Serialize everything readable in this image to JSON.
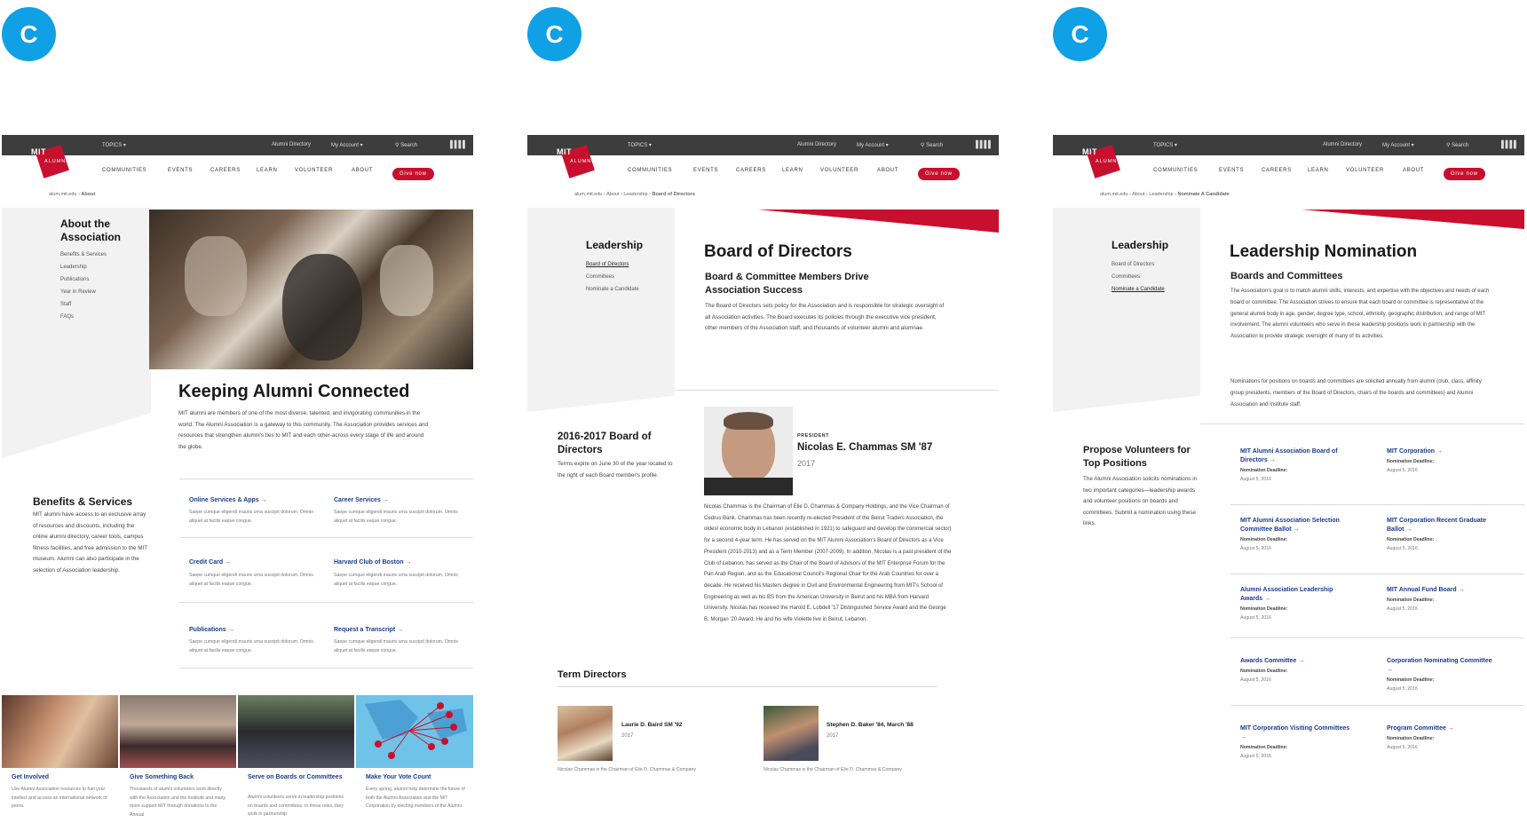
{
  "badge_letter": "C",
  "nav": {
    "topics": "TOPICS ▾",
    "directory": "Alumni Directory",
    "account": "My Account ▾",
    "search": "Search",
    "communities": "COMMUNITIES",
    "events": "EVENTS",
    "careers": "CAREERS",
    "learn": "LEARN",
    "volunteer": "VOLUNTEER",
    "about": "ABOUT",
    "give": "Give now",
    "logo_mit": "MIT",
    "logo_alumni": "ALUMNI"
  },
  "colors": {
    "accent": "#c8102e",
    "badge": "#0fa0e6",
    "link": "#1a3b8c",
    "topbar": "#3d3d3d"
  },
  "page1": {
    "crumb": [
      "alum.mit.edu",
      "About"
    ],
    "side_title": "About the Association",
    "side_links": [
      "Benefits & Services",
      "Leadership",
      "Publications",
      "Year in Review",
      "Staff",
      "FAQs"
    ],
    "title": "Keeping Alumni Connected",
    "intro": "MIT alumni are members of one of the most diverse, talented, and invigorating communities in the world. The Alumni Association is a gateway to this community. The Association provides services and resources that strengthen alumni's ties to MIT and each other-across every stage of life and around the globe.",
    "benefits_title": "Benefits & Services",
    "benefits_text": "MIT alumni have access to an exclusive array of resources and discounts, including the online alumni directory, career tools, campus fitness facilities, and free admission to the MIT museum. Alumni can also participate in the selection of Association leadership.",
    "links": [
      {
        "label": "Online Services & Apps",
        "desc": "Saepe cumque eligendi mauris urna suscipit dolorum. Omnis aliquet at facilis eaque congue."
      },
      {
        "label": "Career Services",
        "desc": "Saepe cumque eligendi mauris urna suscipit dolorum. Omnis aliquet at facilis eaque congue."
      },
      {
        "label": "Credit Card",
        "desc": "Saepe cumque eligendi mauris urna suscipit dolorum. Omnis aliquet at facilis eaque congue."
      },
      {
        "label": "Harvard Club of Boston",
        "desc": "Saepe cumque eligendi mauris urna suscipit dolorum. Omnis aliquet at facilis eaque congue."
      },
      {
        "label": "Publications",
        "desc": "Saepe cumque eligendi mauris urna suscipit dolorum. Omnis aliquet at facilis eaque congue."
      },
      {
        "label": "Request a Transcript",
        "desc": "Saepe cumque eligendi mauris urna suscipit dolorum. Omnis aliquet at facilis eaque congue."
      }
    ],
    "tiles": [
      {
        "title": "Get Involved",
        "desc": "Use Alumni Association resources to fuel your intellect and access an international network of peers."
      },
      {
        "title": "Give Something Back",
        "desc": "Thousands of alumni volunteers work directly with the Association and the Institute and many more support MIT through donations to the Annual"
      },
      {
        "title": "Serve on Boards or Committees",
        "desc": "Alumni volunteers serve in leadership positions on boards and committees. In these roles, they work in partnership"
      },
      {
        "title": "Make Your Vote Count",
        "desc": "Every spring, alumni help determine the future of both the Alumni Association and the MIT Corporation by electing members of the Alumni"
      }
    ]
  },
  "page2": {
    "crumb": [
      "alum.mit.edu",
      "About",
      "Leadership",
      "Board of Directors"
    ],
    "side_title": "Leadership",
    "side_links": [
      "Board of Directors",
      "Committees",
      "Nominate a Candidate"
    ],
    "title": "Board of Directors",
    "subtitle": "Board & Committee Members Drive Association Success",
    "intro": "The Board of Directors sets policy for the Association and is responsible for strategic oversight of all Association activities. The Board executes its policies through the executive vice president, other members of the Association staff, and thousands of volunteer alumni and alumnae.",
    "term_title": "2016-2017 Board of Directors",
    "term_text": "Terms expire on June 30 of the year located to the right of each Board member's profile.",
    "president_label": "PRESIDENT",
    "president_name": "Nicolas E. Chammas SM '87",
    "president_year": "2017",
    "bio": "Nicolas Chammas is the Chairman of Elie D. Chammas & Company Holdings, and the Vice Chairman of Cedrus Bank. Chammas has been recently re-elected President of the Beirut Traders Association, the oldest economic body in Lebanon (established in 1921) to safeguard and develop the commercial sector) for a second 4-year term. He has served on the MIT Alumni Association's Board of Directors as a Vice President (2010-2013) and as a Term Member (2007-2009). In addition, Nicolas is a past president of the Club of Lebanon, has served as the Chair of the Board of Advisors of the MIT Enterprise Forum for the Pan Arab Region, and as the Educational Council's Regional Chair for the Arab Countries for over a decade. He received his Masters degree in Civil and Environmental Engineering from MIT's School of Engineering as well as his BS from the American University in Beirut and his MBA from Harvard University. Nicolas has received the Harold E. Lobdell '17 Distinguished Service Award and the George B. Morgan '20 Award. He and his wife Violette live in Beirut, Lebanon.",
    "term_directors": "Term Directors",
    "directors": [
      {
        "name": "Laurie D. Baird SM '92",
        "year": "2017",
        "desc": "Nicolas Chammas is the Chairman of Elie D. Chammas & Company"
      },
      {
        "name": "Stephen D. Baker '84, March '88",
        "year": "2017",
        "desc": "Nicolas Chammas is the Chairman of Elie D. Chammas & Company"
      }
    ]
  },
  "page3": {
    "crumb": [
      "alum.mit.edu",
      "About",
      "Leadership",
      "Nominate A Candidate"
    ],
    "side_title": "Leadership",
    "side_links": [
      "Board of Directors",
      "Committees",
      "Nominate a Candidate"
    ],
    "title": "Leadership Nomination",
    "subtitle": "Boards and Committees",
    "intro1": "The Association's goal is to match alumni skills, interests, and expertise with the objectives and needs of each board or committee. The Association strives to ensure that each board or committee is representative of the general alumni body in age, gender, degree type, school, ethnicity, geographic distribution, and range of MIT involvement. The alumni volunteers who serve in these leadership positions work in partnership with the Association to provide strategic oversight of many of its activities.",
    "intro2": "Nominations for positions on boards and committees are solicited annually from alumni (club, class, affinity group presidents, members of the Board of Directors, chairs of the boards and committees) and Alumni Association and Institute staff.",
    "propose_title": "Propose Volunteers for Top Positions",
    "propose_text": "The Alumni Association solicits nominations in two important categories—leadership awards and volunteer positions on boards and committees. Submit a nomination using these links.",
    "deadline_label": "Nomination Deadline:",
    "deadline_date": "August 5, 2016",
    "items": [
      "MIT Alumni Association Board of Directors",
      "MIT Corporation",
      "MIT Alumni Association Selection Committee Ballot",
      "MIT Corporation Recent Graduate Ballot",
      "Alumni Association Leadership Awards",
      "MIT Annual Fund Board",
      "Awards Committee",
      "Corporation Nominating Committee",
      "MIT Corporation Visiting Committees",
      "Program Committee"
    ]
  }
}
